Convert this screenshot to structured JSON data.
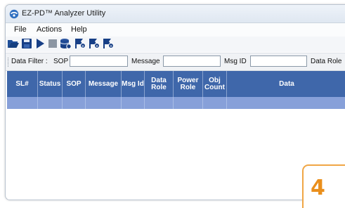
{
  "window": {
    "title": "EZ-PD™ Analyzer Utility"
  },
  "menu": {
    "items": [
      "File",
      "Actions",
      "Help"
    ]
  },
  "toolbar": {
    "buttons": [
      "open-folder-icon",
      "save-icon",
      "play-icon",
      "stop-icon",
      "database-icon",
      "flag-icon-1",
      "flag-icon-2",
      "flag-icon-3"
    ]
  },
  "filter": {
    "label": "Data Filter :",
    "fields": [
      {
        "label": "SOP",
        "value": ""
      },
      {
        "label": "Message",
        "value": ""
      },
      {
        "label": "Msg ID",
        "value": ""
      },
      {
        "label": "Data Role",
        "value": ""
      }
    ]
  },
  "table": {
    "columns": [
      "SL#",
      "Status",
      "SOP",
      "Message",
      "Msg Id",
      "Data Role",
      "Power Role",
      "Obj Count",
      "Data"
    ],
    "rows": [
      [
        "",
        "",
        "",
        "",
        "",
        "",
        "",
        "",
        ""
      ]
    ]
  },
  "badge": {
    "number": "4"
  },
  "colors": {
    "header_bg": "#3f67aa",
    "selected_row": "#87a0d9",
    "badge_accent": "#ea8f1c"
  }
}
